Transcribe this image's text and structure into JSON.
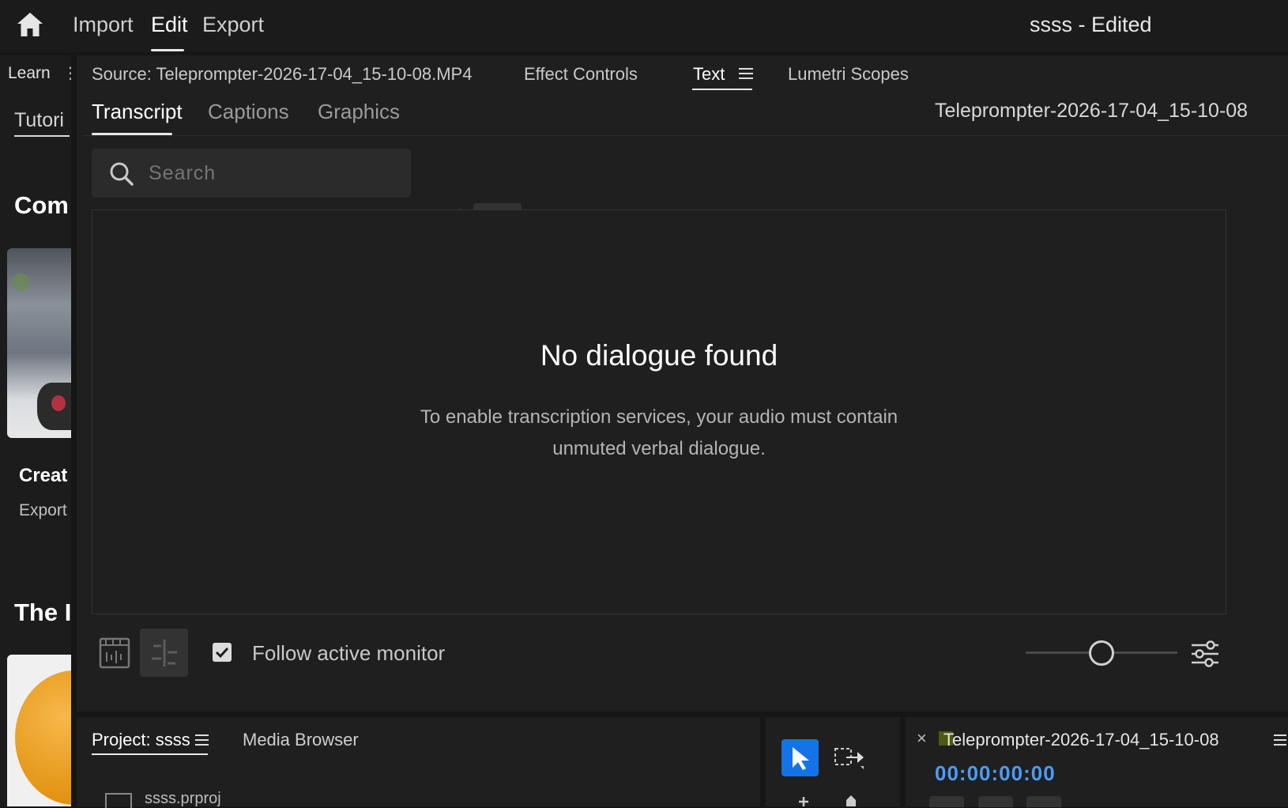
{
  "topbar": {
    "home_icon": "home-icon",
    "nav": [
      "Import",
      "Edit",
      "Export"
    ],
    "project_title": "ssss",
    "project_status": "- Edited"
  },
  "learn_panel": {
    "tab_label": "Learn",
    "section_tab": "Tutori",
    "heading1": "Com",
    "card_title": "Creat",
    "card_subtitle": "Export",
    "heading2": "The I"
  },
  "text_panel": {
    "tabs": {
      "source": "Source: Teleprompter-2026-17-04_15-10-08.MP4",
      "effect_controls": "Effect Controls",
      "text": "Text",
      "lumetri": "Lumetri Scopes"
    },
    "subtabs": [
      "Transcript",
      "Captions",
      "Graphics"
    ],
    "clip_name": "Teleprompter-2026-17-04_15-10-08",
    "search_placeholder": "Search",
    "empty_title": "No dialogue found",
    "empty_line1": "To enable transcription services, your audio must contain",
    "empty_line2": "unmuted verbal dialogue.",
    "follow_label": "Follow active monitor",
    "follow_checked": true,
    "zoom_level": 0.5
  },
  "project_panel": {
    "tabs": [
      "Project: ssss",
      "Media Browser"
    ],
    "file_name": "ssss.prproj"
  },
  "sequence_panel": {
    "name": "Teleprompter-2026-17-04_15-10-08",
    "timecode": "00:00:00:00"
  },
  "colors": {
    "accent_blue": "#1473e6",
    "timecode_blue": "#4b9cf5",
    "sequence_swatch": "#4c5a12"
  }
}
